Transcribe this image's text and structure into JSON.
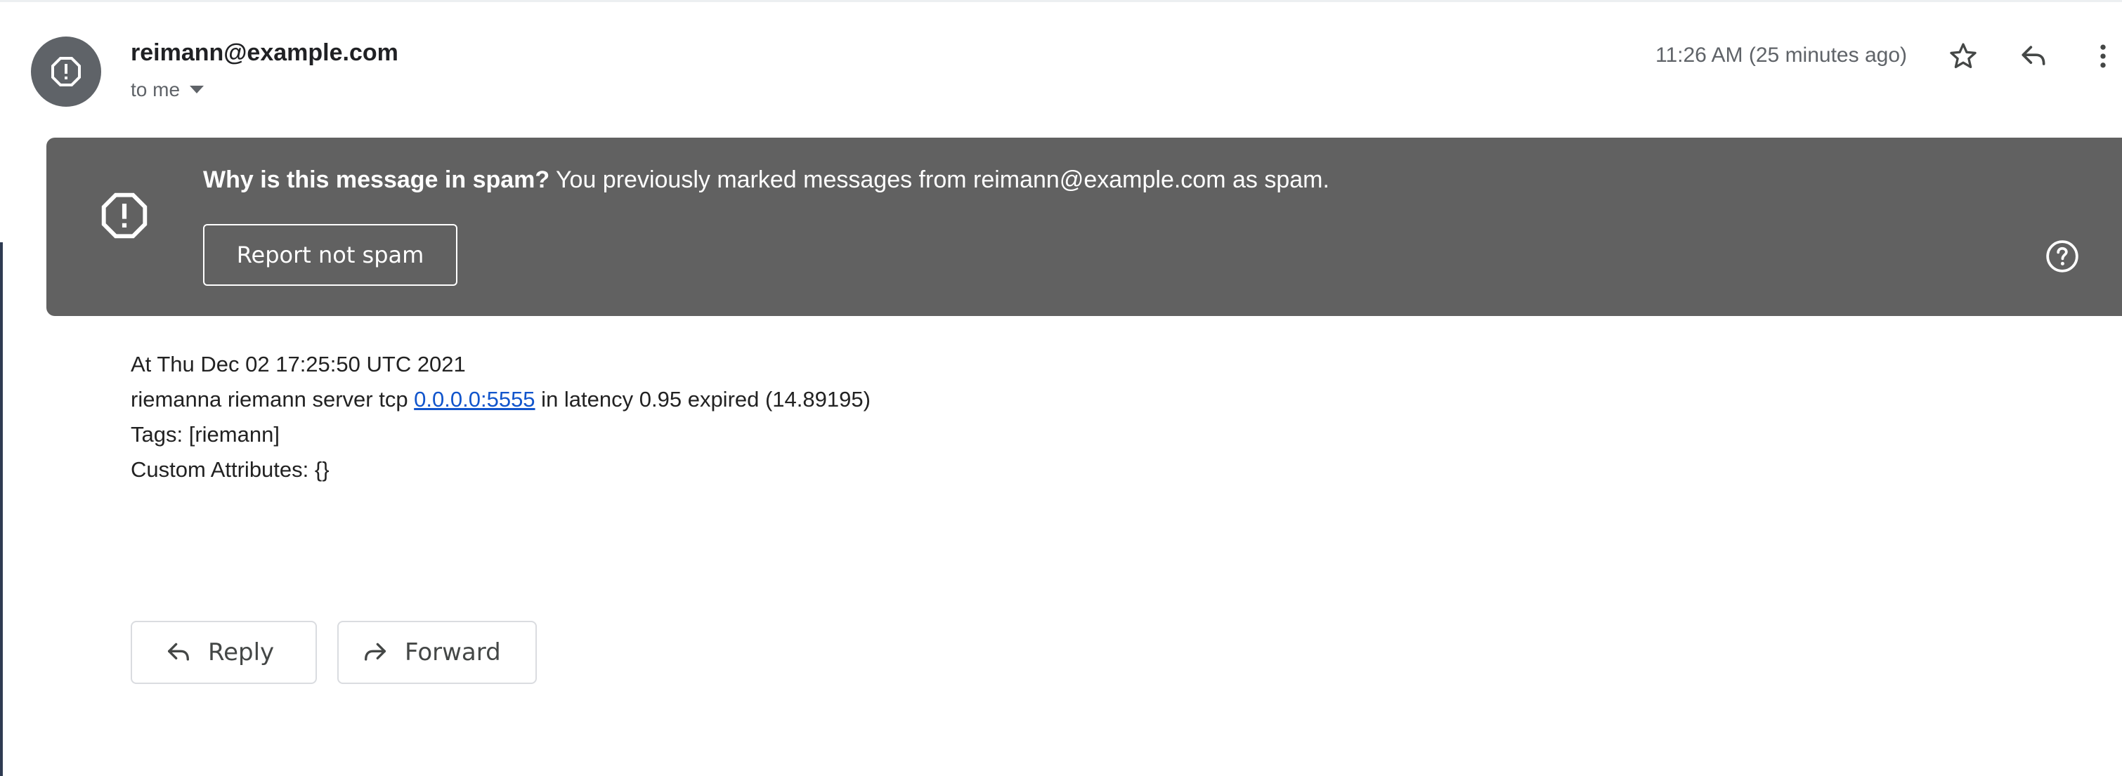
{
  "header": {
    "sender": "reimann@example.com",
    "recipient": "to me",
    "timestamp": "11:26 AM (25 minutes ago)",
    "icons": [
      "alert-octagon-icon",
      "caret-down-icon",
      "star-icon",
      "reply-icon",
      "more-vert-icon"
    ]
  },
  "spam_banner": {
    "title": "Why is this message in spam?",
    "reason": " You previously marked messages from reimann@example.com as spam.",
    "report_button": "Report not spam",
    "icons": [
      "alert-octagon-icon",
      "help-icon"
    ],
    "background_color": "#616161"
  },
  "message": {
    "line1": "At Thu Dec 02 17:25:50 UTC 2021",
    "line2_before": "riemanna riemann server tcp ",
    "line2_link": "0.0.0.0:5555",
    "line2_after": " in latency 0.95 expired (14.89195)",
    "line3": "Tags: [riemann]",
    "line4": "Custom Attributes: {}"
  },
  "actions": {
    "reply_label": "Reply",
    "forward_label": "Forward"
  },
  "colors": {
    "link": "#1155cc",
    "avatar": "#5f6368"
  }
}
